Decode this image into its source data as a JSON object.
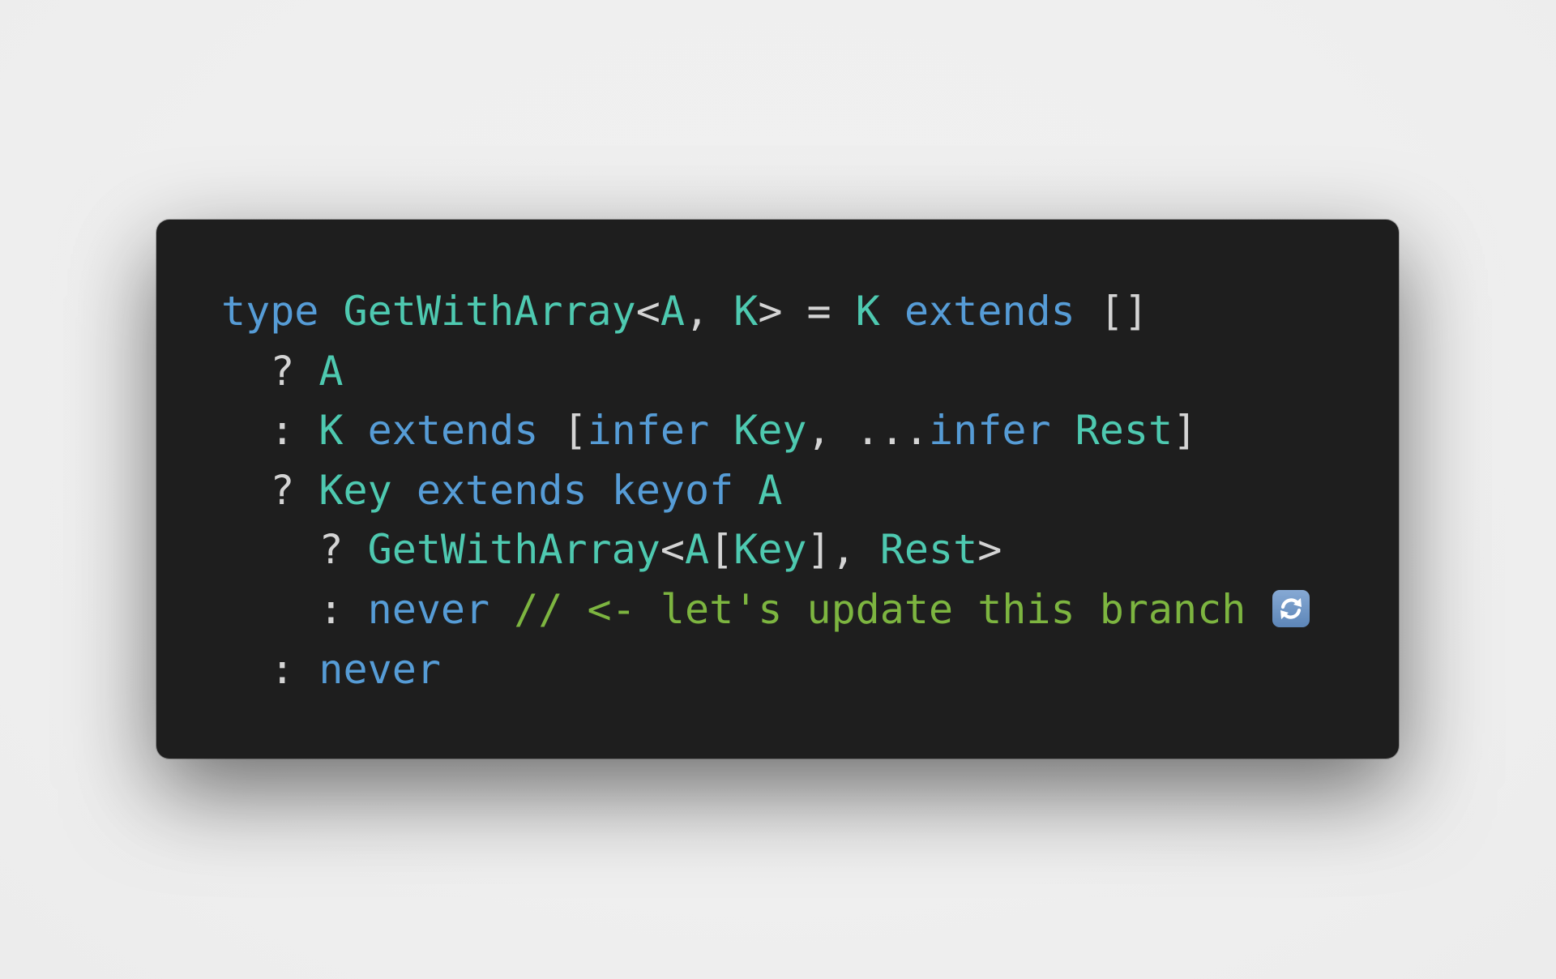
{
  "editor": {
    "language": "typescript",
    "theme_colors": {
      "background": "#1e1e1e",
      "keyword": "#569cd6",
      "type": "#4ec9b0",
      "punctuation": "#d4d4d4",
      "comment": "#7db540",
      "page_background": "#f0f0f0"
    },
    "lines": [
      {
        "tokens": [
          {
            "kind": "kw",
            "text": "type"
          },
          {
            "kind": "pu",
            "text": " "
          },
          {
            "kind": "ty",
            "text": "GetWithArray"
          },
          {
            "kind": "pu",
            "text": "<"
          },
          {
            "kind": "ty",
            "text": "A"
          },
          {
            "kind": "pu",
            "text": ", "
          },
          {
            "kind": "ty",
            "text": "K"
          },
          {
            "kind": "pu",
            "text": "> = "
          },
          {
            "kind": "ty",
            "text": "K"
          },
          {
            "kind": "pu",
            "text": " "
          },
          {
            "kind": "kw",
            "text": "extends"
          },
          {
            "kind": "pu",
            "text": " []"
          }
        ]
      },
      {
        "tokens": [
          {
            "kind": "pu",
            "text": "  ? "
          },
          {
            "kind": "ty",
            "text": "A"
          }
        ]
      },
      {
        "tokens": [
          {
            "kind": "pu",
            "text": "  : "
          },
          {
            "kind": "ty",
            "text": "K"
          },
          {
            "kind": "pu",
            "text": " "
          },
          {
            "kind": "kw",
            "text": "extends"
          },
          {
            "kind": "pu",
            "text": " ["
          },
          {
            "kind": "kw",
            "text": "infer"
          },
          {
            "kind": "pu",
            "text": " "
          },
          {
            "kind": "ty",
            "text": "Key"
          },
          {
            "kind": "pu",
            "text": ", ..."
          },
          {
            "kind": "kw",
            "text": "infer"
          },
          {
            "kind": "pu",
            "text": " "
          },
          {
            "kind": "ty",
            "text": "Rest"
          },
          {
            "kind": "pu",
            "text": "]"
          }
        ]
      },
      {
        "tokens": [
          {
            "kind": "pu",
            "text": "  ? "
          },
          {
            "kind": "ty",
            "text": "Key"
          },
          {
            "kind": "pu",
            "text": " "
          },
          {
            "kind": "kw",
            "text": "extends"
          },
          {
            "kind": "pu",
            "text": " "
          },
          {
            "kind": "kw",
            "text": "keyof"
          },
          {
            "kind": "pu",
            "text": " "
          },
          {
            "kind": "ty",
            "text": "A"
          }
        ]
      },
      {
        "tokens": [
          {
            "kind": "pu",
            "text": "    ? "
          },
          {
            "kind": "ty",
            "text": "GetWithArray"
          },
          {
            "kind": "pu",
            "text": "<"
          },
          {
            "kind": "ty",
            "text": "A"
          },
          {
            "kind": "pu",
            "text": "["
          },
          {
            "kind": "ty",
            "text": "Key"
          },
          {
            "kind": "pu",
            "text": "], "
          },
          {
            "kind": "ty",
            "text": "Rest"
          },
          {
            "kind": "pu",
            "text": ">"
          }
        ]
      },
      {
        "tokens": [
          {
            "kind": "pu",
            "text": "    : "
          },
          {
            "kind": "kw",
            "text": "never"
          },
          {
            "kind": "pu",
            "text": " "
          },
          {
            "kind": "cm",
            "text": "// <- let's update this branch "
          }
        ],
        "trailing_icon": "counterclockwise-arrows-emoji"
      },
      {
        "tokens": [
          {
            "kind": "pu",
            "text": "  : "
          },
          {
            "kind": "kw",
            "text": "never"
          }
        ]
      }
    ]
  }
}
